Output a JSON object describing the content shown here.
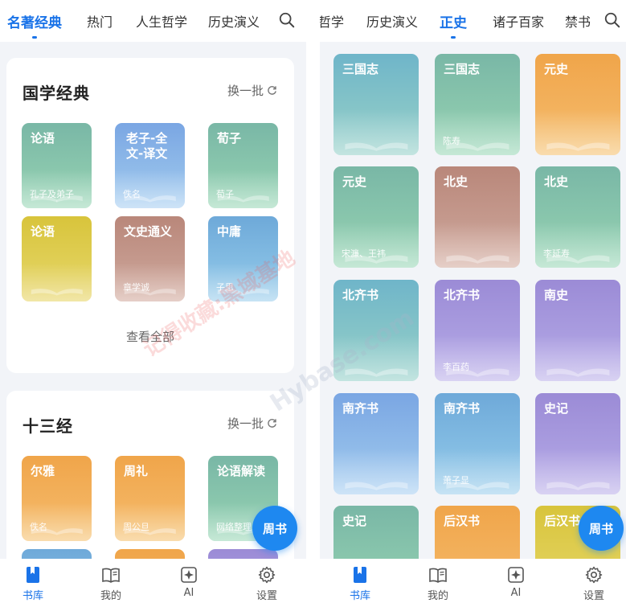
{
  "left": {
    "tabs": [
      {
        "label": "名著经典",
        "active": true
      },
      {
        "label": "热门",
        "active": false
      },
      {
        "label": "人生哲学",
        "active": false
      },
      {
        "label": "历史演义",
        "active": false
      }
    ],
    "sections": [
      {
        "title": "国学经典",
        "refresh_label": "换一批",
        "books": [
          {
            "title": "论语",
            "author": "孔子及弟子",
            "color": "green"
          },
          {
            "title": "老子-全文-译文",
            "author": "佚名",
            "color": "blue"
          },
          {
            "title": "荀子",
            "author": "荀子",
            "color": "green"
          },
          {
            "title": "论语",
            "author": "",
            "color": "yellow"
          },
          {
            "title": "文史通义",
            "author": "章学诚",
            "color": "brown"
          },
          {
            "title": "中庸",
            "author": "子思",
            "color": "lightblue"
          }
        ],
        "see_all": "查看全部"
      },
      {
        "title": "十三经",
        "refresh_label": "换一批",
        "books": [
          {
            "title": "尔雅",
            "author": "佚名",
            "color": "orange"
          },
          {
            "title": "周礼",
            "author": "周公旦",
            "color": "orange"
          },
          {
            "title": "论语解读",
            "author": "网络整理",
            "color": "green"
          }
        ]
      }
    ],
    "fab_label": "周书"
  },
  "right": {
    "tabs": [
      {
        "label": "哲学",
        "active": false
      },
      {
        "label": "历史演义",
        "active": false
      },
      {
        "label": "正史",
        "active": true
      },
      {
        "label": "诸子百家",
        "active": false
      },
      {
        "label": "禁书",
        "active": false
      }
    ],
    "books": [
      {
        "title": "三国志",
        "author": "",
        "color": "teal"
      },
      {
        "title": "三国志",
        "author": "陈寿",
        "color": "green"
      },
      {
        "title": "元史",
        "author": "",
        "color": "orange"
      },
      {
        "title": "元史",
        "author": "宋濂、王祎",
        "color": "green"
      },
      {
        "title": "北史",
        "author": "",
        "color": "brown"
      },
      {
        "title": "北史",
        "author": "李延寿",
        "color": "green"
      },
      {
        "title": "北齐书",
        "author": "",
        "color": "teal"
      },
      {
        "title": "北齐书",
        "author": "李百药",
        "color": "purple"
      },
      {
        "title": "南史",
        "author": "",
        "color": "purple"
      },
      {
        "title": "南齐书",
        "author": "",
        "color": "blue"
      },
      {
        "title": "南齐书",
        "author": "萧子显",
        "color": "lightblue"
      },
      {
        "title": "史记",
        "author": "",
        "color": "purple"
      },
      {
        "title": "史记",
        "author": "",
        "color": "green"
      },
      {
        "title": "后汉书",
        "author": "",
        "color": "orange"
      },
      {
        "title": "后汉书",
        "author": "",
        "color": "yellow"
      }
    ],
    "fab_label": "周书"
  },
  "bottom_nav": [
    {
      "label": "书库",
      "icon": "bookmark-book-icon",
      "active": true
    },
    {
      "label": "我的",
      "icon": "open-book-icon",
      "active": false
    },
    {
      "label": "AI",
      "icon": "ai-sparkle-icon",
      "active": false
    },
    {
      "label": "设置",
      "icon": "gear-icon",
      "active": false
    }
  ],
  "watermark": "记得收藏:黑域基地",
  "watermark_url": "Hybase.com",
  "colors": {
    "accent": "#1a73e8",
    "background": "#f2f4f8",
    "fab": "#1e88f0"
  }
}
